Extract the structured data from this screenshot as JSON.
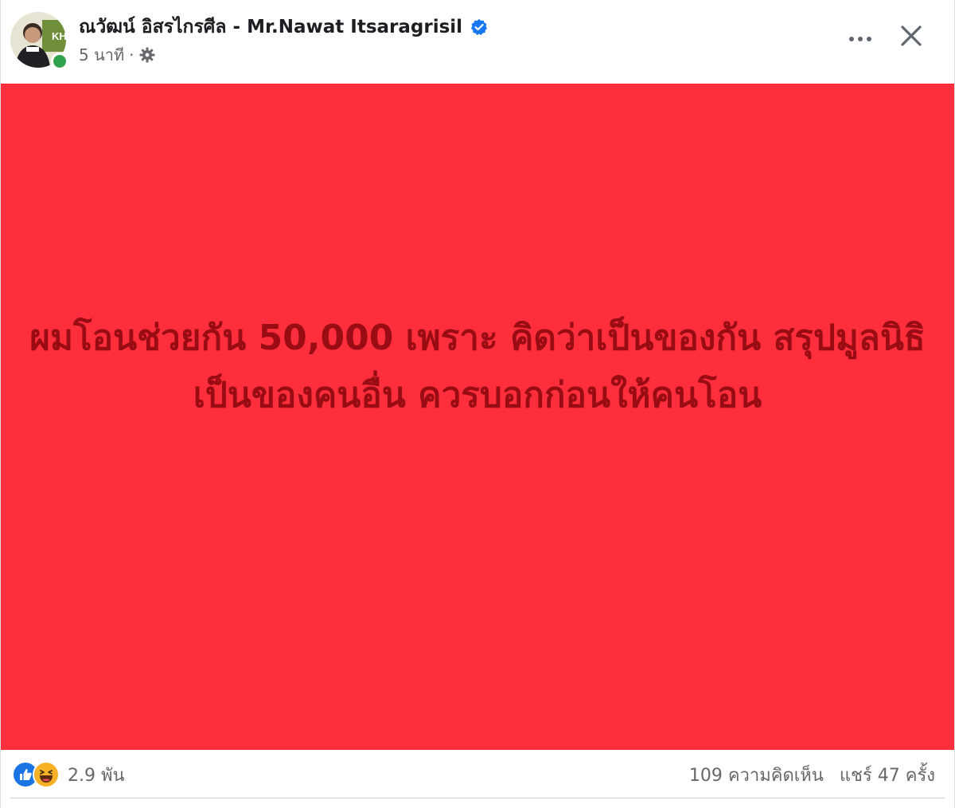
{
  "post": {
    "author_name": "ณวัฒน์ อิสรไกรศีล - Mr.Nawat Itsaragrisil",
    "time": "5 นาที",
    "meta_separator": "·",
    "verified_icon": "verified-badge-icon",
    "privacy_icon": "gear-icon",
    "more_icon": "more-horizontal-icon",
    "close_icon": "close-icon",
    "background_color": "#fe2e3c",
    "text_color": "#9a0c14",
    "body_text": "ผมโอนช่วยกัน 50,000 เพราะ คิดว่าเป็นของกัน สรุปมูลนิธิเป็นของคนอื่น ควรบอกก่อนให้คนโอน"
  },
  "footer": {
    "reaction_icons": [
      "like-icon",
      "haha-icon"
    ],
    "reaction_count": "2.9 พัน",
    "comments": "109 ความคิดเห็น",
    "shares": "แชร์ 47 ครั้ง"
  }
}
